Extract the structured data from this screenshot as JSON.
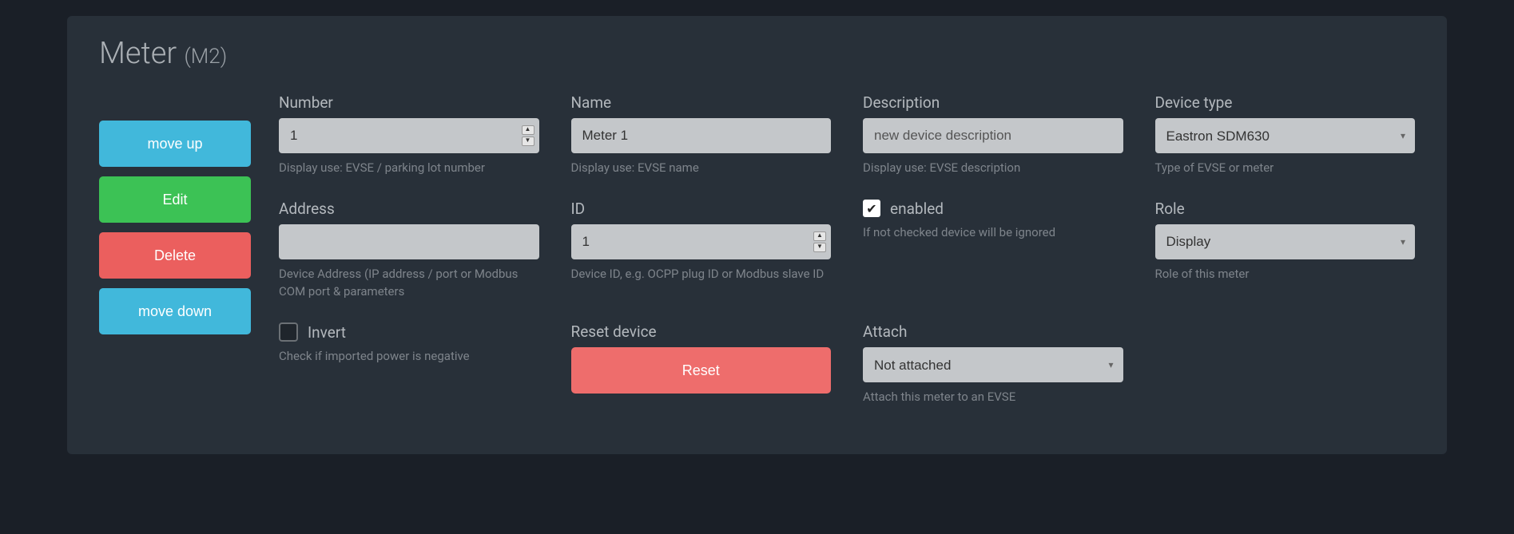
{
  "title_main": "Meter",
  "title_sub": "(M2)",
  "sidebar": {
    "move_up": "move up",
    "edit": "Edit",
    "delete": "Delete",
    "move_down": "move down"
  },
  "fields": {
    "number": {
      "label": "Number",
      "value": "1",
      "help": "Display use: EVSE / parking lot number"
    },
    "name": {
      "label": "Name",
      "value": "Meter 1",
      "help": "Display use: EVSE name"
    },
    "description": {
      "label": "Description",
      "placeholder": "new device description",
      "help": "Display use: EVSE description"
    },
    "device_type": {
      "label": "Device type",
      "value": "Eastron SDM630",
      "help": "Type of EVSE or meter"
    },
    "address": {
      "label": "Address",
      "value": "",
      "help": "Device Address (IP address / port or Modbus COM port & parameters"
    },
    "id": {
      "label": "ID",
      "value": "1",
      "help": "Device ID, e.g. OCPP plug ID or Modbus slave ID"
    },
    "enabled": {
      "label": "enabled",
      "checked": true,
      "help": "If not checked device will be ignored"
    },
    "role": {
      "label": "Role",
      "value": "Display",
      "help": "Role of this meter"
    },
    "invert": {
      "label": "Invert",
      "checked": false,
      "help": "Check if imported power is negative"
    },
    "reset": {
      "label": "Reset device",
      "button": "Reset"
    },
    "attach": {
      "label": "Attach",
      "value": "Not attached",
      "help": "Attach this meter to an EVSE"
    }
  }
}
